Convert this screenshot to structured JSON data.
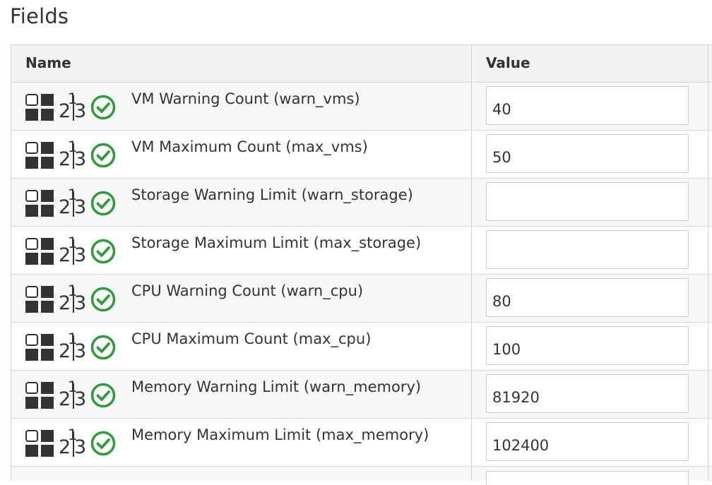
{
  "page": {
    "title": "Fields"
  },
  "table": {
    "headers": {
      "name": "Name",
      "value": "Value"
    },
    "rows": [
      {
        "label": "VM Warning Count (warn_vms)",
        "value": ""
      },
      {
        "label": "VM Maximum Count (max_vms)",
        "value": ""
      },
      {
        "label": "Storage Warning Limit (warn_storage)",
        "value": ""
      },
      {
        "label": "Storage Maximum Limit (max_storage)",
        "value": ""
      },
      {
        "label": "CPU Warning Count (warn_cpu)",
        "value": ""
      },
      {
        "label": "CPU Maximum Count (max_cpu)",
        "value": ""
      },
      {
        "label": "Memory Warning Limit (warn_memory)",
        "value": ""
      },
      {
        "label": "Memory Maximum Limit (max_memory)",
        "value": ""
      }
    ],
    "row_values": [
      "40",
      "50",
      "",
      "",
      "80",
      "100",
      "81920",
      "102400"
    ],
    "row_icons": [
      "field-type-icon",
      "number-type-icon",
      "valid-check-icon"
    ]
  },
  "colors": {
    "check_green": "#2e9a3a",
    "grid_border": "#d1d1d1",
    "header_bg": "#f2f2f2",
    "row_alt_bg": "#f7f7f7"
  }
}
